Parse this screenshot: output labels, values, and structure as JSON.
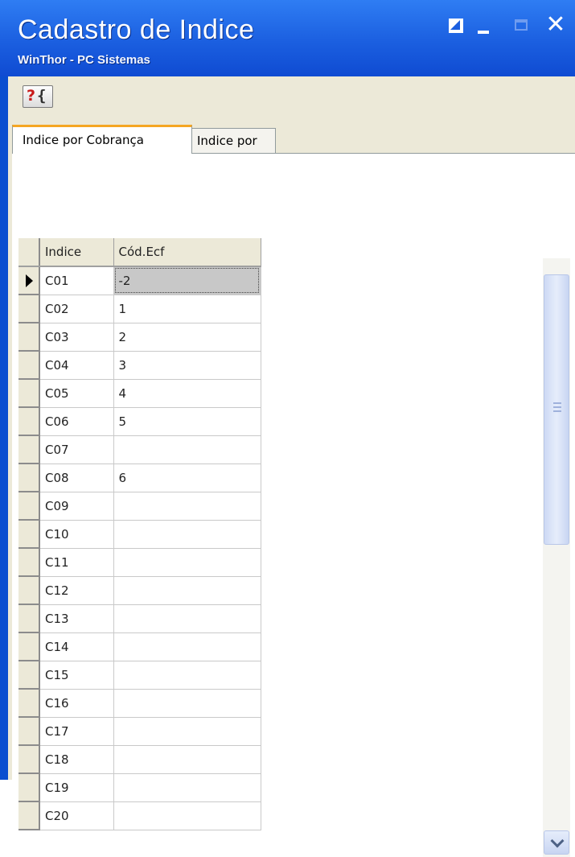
{
  "window": {
    "title": "Cadastro de Indice",
    "subtitle": "WinThor - PC Sistemas",
    "controls": {
      "close_glyph": "✕",
      "restore_icon": "restore-icon",
      "minimize_icon": "minimize-icon",
      "maximize_icon": "maximize-icon"
    }
  },
  "toolbar": {
    "help_button": {
      "q": "?",
      "bracket": "{",
      "icon": "help-icon"
    }
  },
  "tabs": [
    {
      "label": "Indice por Cobrança",
      "active": true
    },
    {
      "label": "Indice por",
      "active": false
    }
  ],
  "grid": {
    "columns": [
      "Indice",
      "Cód.Ecf"
    ],
    "rows": [
      {
        "indice": "C01",
        "cod_ecf": "-2",
        "selected": true
      },
      {
        "indice": "C02",
        "cod_ecf": "1"
      },
      {
        "indice": "C03",
        "cod_ecf": "2"
      },
      {
        "indice": "C04",
        "cod_ecf": "3"
      },
      {
        "indice": "C05",
        "cod_ecf": "4"
      },
      {
        "indice": "C06",
        "cod_ecf": "5"
      },
      {
        "indice": "C07",
        "cod_ecf": ""
      },
      {
        "indice": "C08",
        "cod_ecf": "6"
      },
      {
        "indice": "C09",
        "cod_ecf": ""
      },
      {
        "indice": "C10",
        "cod_ecf": ""
      },
      {
        "indice": "C11",
        "cod_ecf": ""
      },
      {
        "indice": "C12",
        "cod_ecf": ""
      },
      {
        "indice": "C13",
        "cod_ecf": ""
      },
      {
        "indice": "C14",
        "cod_ecf": ""
      },
      {
        "indice": "C15",
        "cod_ecf": ""
      },
      {
        "indice": "C16",
        "cod_ecf": ""
      },
      {
        "indice": "C17",
        "cod_ecf": ""
      },
      {
        "indice": "C18",
        "cod_ecf": ""
      },
      {
        "indice": "C19",
        "cod_ecf": ""
      },
      {
        "indice": "C20",
        "cod_ecf": ""
      }
    ]
  },
  "colors": {
    "titlebar": "#1b5fe0",
    "face": "#ece9d8",
    "tab_highlight": "#f5a623",
    "selected_cell": "#c8c8c8"
  }
}
